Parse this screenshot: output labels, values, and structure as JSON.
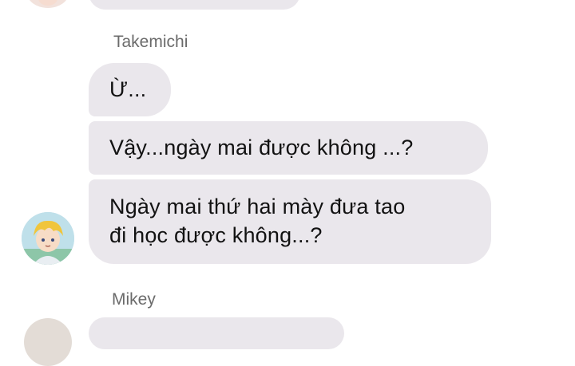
{
  "conversation": {
    "groups": [
      {
        "sender": "Takemichi",
        "messages": [
          "Ừ...",
          "Vậy...ngày mai được không ...?",
          "Ngày mai thứ hai mày đưa tao\nđi học được không...?"
        ]
      },
      {
        "sender": "Mikey",
        "messages": []
      }
    ]
  },
  "colors": {
    "bubble_background": "#eae7ec",
    "text": "#121212",
    "sender_name": "#6b6b6b",
    "page_background": "#ffffff"
  }
}
